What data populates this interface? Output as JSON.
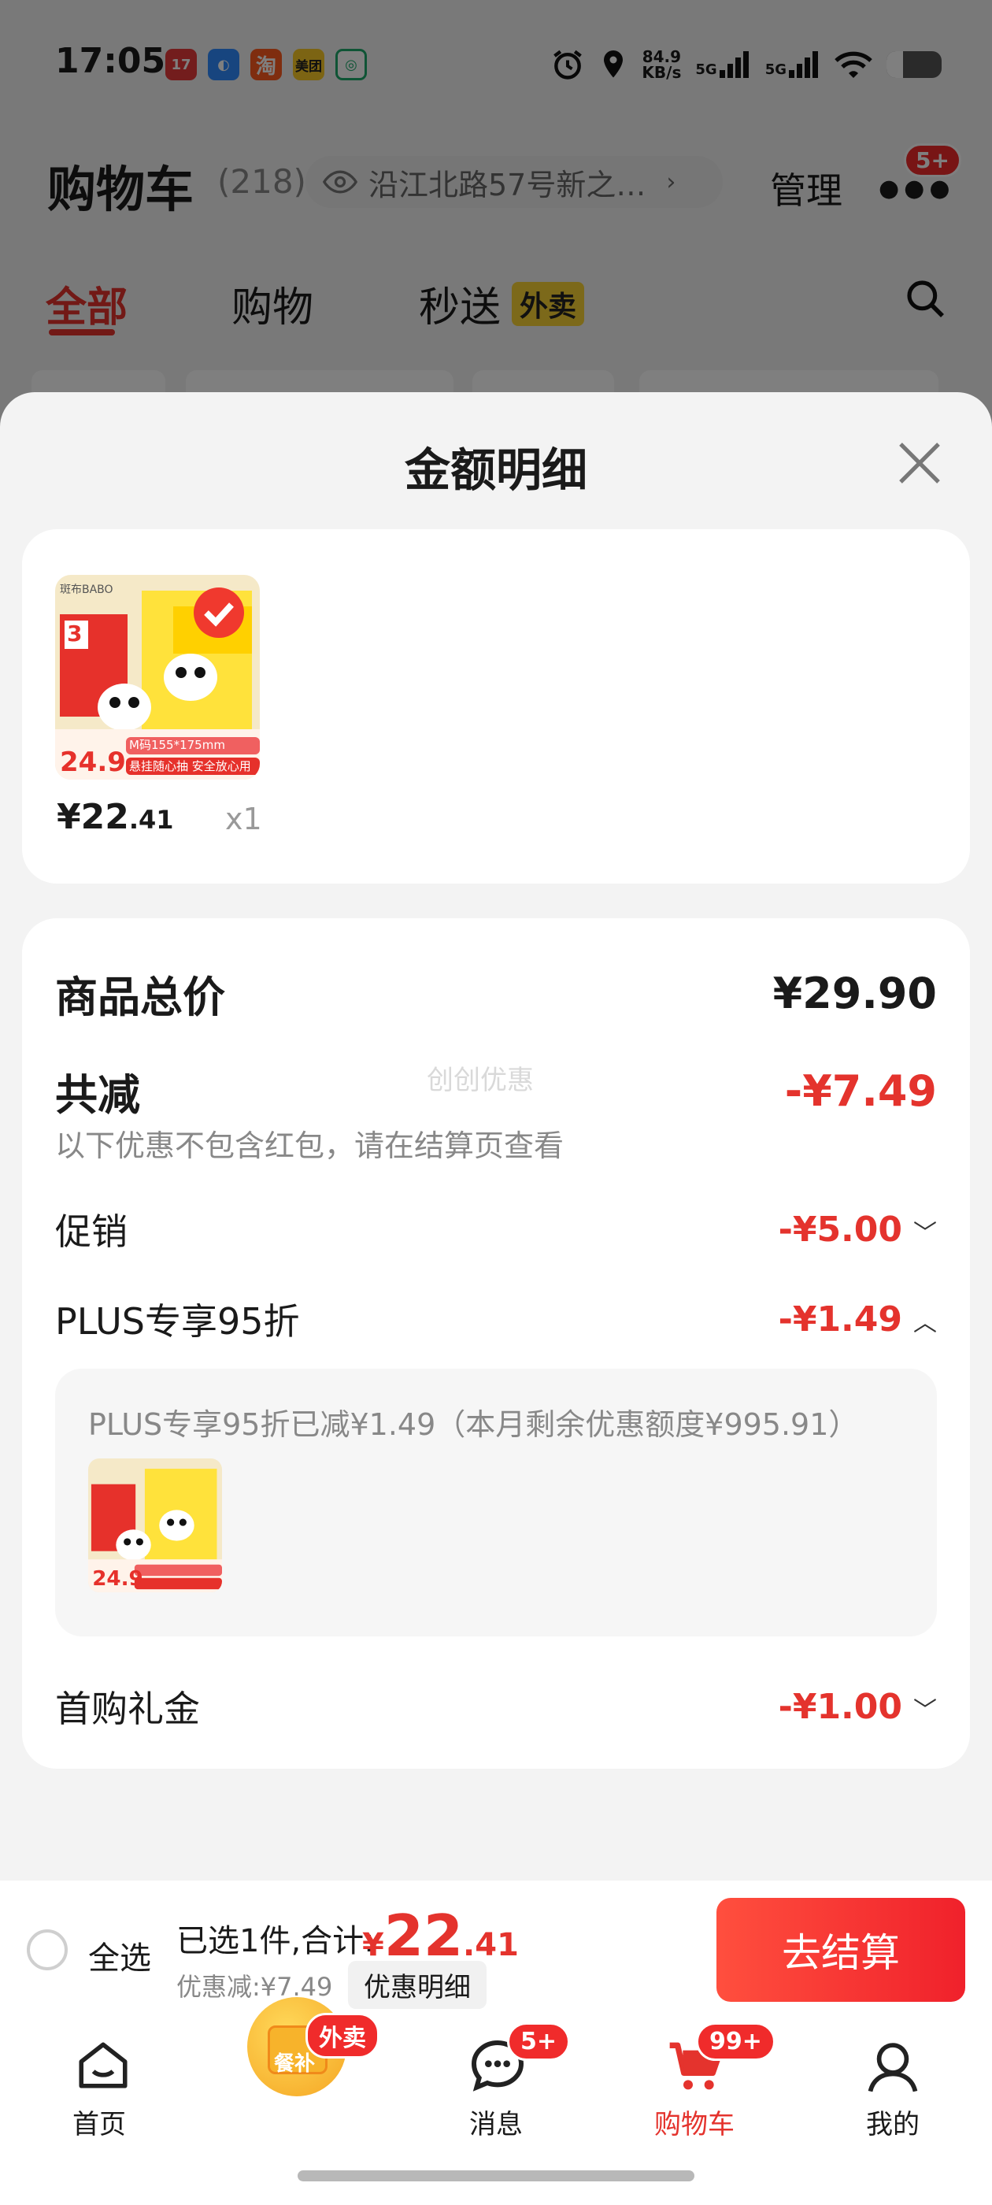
{
  "status_bar": {
    "time": "17:05",
    "apps": [
      {
        "icon": "app-icon-1",
        "label": "17",
        "color": "#e63a3a"
      },
      {
        "icon": "app-icon-2",
        "label": "",
        "color": "#2f8bff"
      },
      {
        "icon": "taobao-icon",
        "label": "淘",
        "color": "#ff5a1f"
      },
      {
        "icon": "meituan-icon",
        "label": "美团",
        "color": "#f8c927"
      },
      {
        "icon": "app-icon-5",
        "label": "",
        "color": "#1fa86b"
      }
    ],
    "net_speed": "84.9",
    "net_unit": "KB/s",
    "sig1": "5G",
    "sig2": "5G",
    "battery_level": 0.3
  },
  "header": {
    "title": "购物车",
    "count": "(218)",
    "address": "沿江北路57号新之…",
    "manage": "管理",
    "more_badge": "5+"
  },
  "tabs": {
    "all": "全部",
    "shop": "购物",
    "instant": "秒送",
    "takeout_tag": "外卖"
  },
  "sheet": {
    "title": "金额明细",
    "product": {
      "price_int": "¥22",
      "price_dec": ".41",
      "qty": "x1",
      "image_brand": "斑布BABO",
      "image_price": "24.9",
      "image_size": "M码155*175mm",
      "image_slogan": "悬挂随心抽 安全放心用",
      "image_count": "3"
    },
    "summary": {
      "total_label": "商品总价",
      "total_value": "¥29.90",
      "reduce_label": "共减",
      "reduce_value": "-¥7.49",
      "note": "以下优惠不包含红包，请在结算页查看",
      "watermark": "创创优惠",
      "promo_label": "促销",
      "promo_value": "-¥5.00",
      "plus_label": "PLUS专享95折",
      "plus_value": "-¥1.49",
      "plus_detail": "PLUS专享95折已减¥1.49（本月剩余优惠额度¥995.91）",
      "gift_label": "首购礼金",
      "gift_value": "-¥1.00"
    }
  },
  "footer": {
    "select_all": "全选",
    "selected": "已选1件,合计:",
    "total_symbol": "¥",
    "total_int": "22",
    "total_dec": ".41",
    "discount": "优惠减:¥7.49",
    "detail_button": "优惠明细",
    "checkout": "去结算"
  },
  "nav": {
    "home": "首页",
    "subsidy": "餐补",
    "subsidy_badge": "外卖",
    "messages": "消息",
    "messages_badge": "5+",
    "cart": "购物车",
    "cart_badge": "99+",
    "me": "我的"
  },
  "colors": {
    "accent": "#e4332d",
    "checkout": "#f0212b"
  }
}
